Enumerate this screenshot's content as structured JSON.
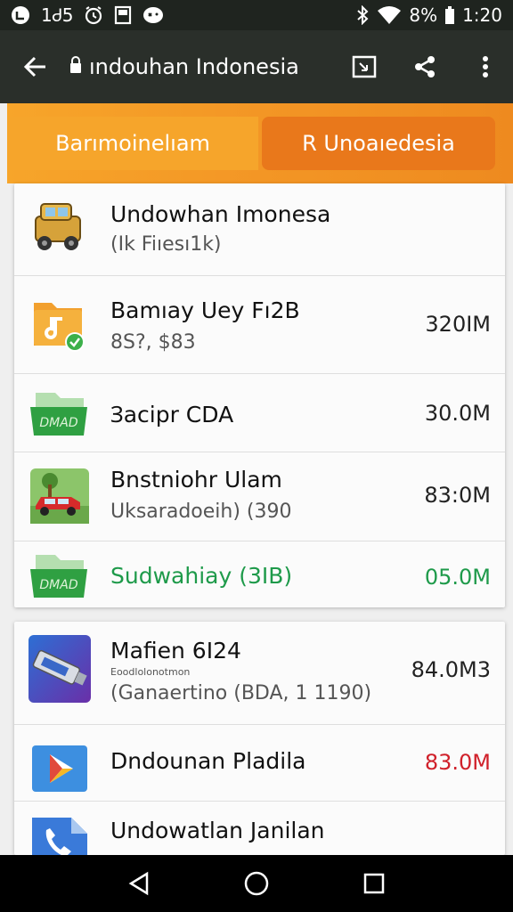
{
  "status_bar": {
    "left_text": "1Ꮷ5",
    "battery": "8%",
    "time": "1:20",
    "icons": [
      "notification-icon",
      "alarm-icon",
      "screenshot-icon",
      "game-icon",
      "bluetooth-icon",
      "wifi-icon",
      "battery-icon"
    ]
  },
  "toolbar": {
    "url": "ındouhan Indonesia",
    "icons": [
      "back-arrow-icon",
      "lock-icon",
      "tab-switch-icon",
      "share-icon",
      "more-vert-icon"
    ]
  },
  "tabs": [
    {
      "label": "Barımoinelıam"
    },
    {
      "label": "R Unoaıedesia"
    }
  ],
  "list_1": [
    {
      "title": "Undowhan Imonesa",
      "subtitle": "(Ik Fiıesı1k)",
      "size": "",
      "icon": "truck-app-icon"
    },
    {
      "title": "Bamıay Uey Fı2B",
      "subtitle": "8S?, $83",
      "size": "320IM",
      "icon": "music-folder-app-icon"
    },
    {
      "title": "Ɜacipr CDA",
      "subtitle": "",
      "size": "30.0M",
      "icon": "dmad-app-icon",
      "icon_text": "DMAD"
    },
    {
      "title": "Bnstniohr Ulam",
      "subtitle": "Uksaradoeih) (390",
      "size": "83:0M",
      "icon": "car-app-icon"
    },
    {
      "title": "Sudwahiay (3IB)",
      "subtitle": "",
      "size": "05.0M",
      "icon": "dmad-app-icon",
      "icon_text": "DMAD"
    }
  ],
  "list_2": [
    {
      "title": "Mafien 6I24",
      "tiny": "Eoodlolonotmon",
      "subtitle": "(Ganaertino (BDA, 1 1190)",
      "size": "84.0M3",
      "icon": "flash-drive-app-icon"
    },
    {
      "title": "Dndounan Pladila",
      "subtitle": "",
      "size": "83.0M",
      "icon": "play-store-icon"
    },
    {
      "title": "Undowatlan Janilan",
      "subtitle": "",
      "size": "",
      "icon": "phone-app-icon"
    }
  ],
  "colors": {
    "green_size": "#1e9a4a",
    "red_size": "#d0202a",
    "tab_orange": "#f39625"
  },
  "nav": {
    "icons": [
      "back-triangle-icon",
      "home-circle-icon",
      "recents-square-icon"
    ]
  }
}
